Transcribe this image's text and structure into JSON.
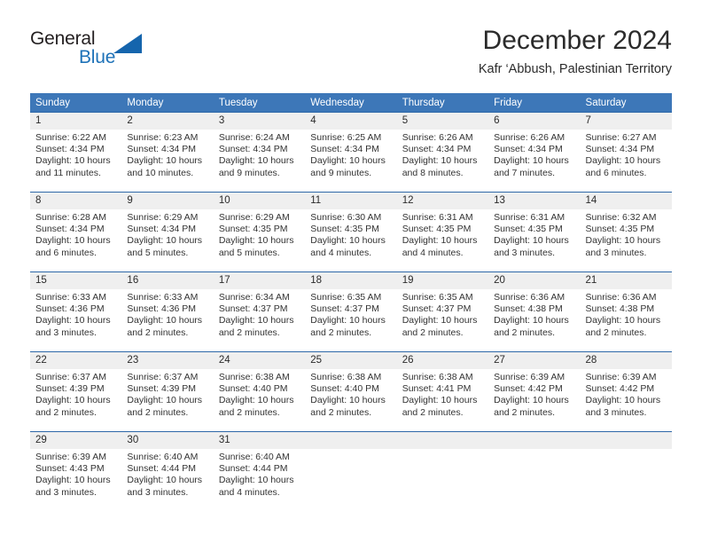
{
  "brand": {
    "name_top": "General",
    "name_bottom": "Blue",
    "triangle_icon": "triangle-icon",
    "accent_color": "#1e72b8"
  },
  "header": {
    "month_title": "December 2024",
    "location": "Kafr ‘Abbush, Palestinian Territory"
  },
  "theme": {
    "header_blue": "#3d77b8",
    "row_border_blue": "#2e68a8",
    "daynum_band": "#efefef"
  },
  "weekday_headers": [
    "Sunday",
    "Monday",
    "Tuesday",
    "Wednesday",
    "Thursday",
    "Friday",
    "Saturday"
  ],
  "labels": {
    "sunrise_prefix": "Sunrise:",
    "sunset_prefix": "Sunset:",
    "daylight_prefix": "Daylight:"
  },
  "calendar_data": {
    "month": "December",
    "year": 2024,
    "first_weekday": "Sunday",
    "weeks": [
      [
        {
          "day": "1",
          "sunrise": "Sunrise: 6:22 AM",
          "sunset": "Sunset: 4:34 PM",
          "daylight_line1": "Daylight: 10 hours",
          "daylight_line2": "and 11 minutes."
        },
        {
          "day": "2",
          "sunrise": "Sunrise: 6:23 AM",
          "sunset": "Sunset: 4:34 PM",
          "daylight_line1": "Daylight: 10 hours",
          "daylight_line2": "and 10 minutes."
        },
        {
          "day": "3",
          "sunrise": "Sunrise: 6:24 AM",
          "sunset": "Sunset: 4:34 PM",
          "daylight_line1": "Daylight: 10 hours",
          "daylight_line2": "and 9 minutes."
        },
        {
          "day": "4",
          "sunrise": "Sunrise: 6:25 AM",
          "sunset": "Sunset: 4:34 PM",
          "daylight_line1": "Daylight: 10 hours",
          "daylight_line2": "and 9 minutes."
        },
        {
          "day": "5",
          "sunrise": "Sunrise: 6:26 AM",
          "sunset": "Sunset: 4:34 PM",
          "daylight_line1": "Daylight: 10 hours",
          "daylight_line2": "and 8 minutes."
        },
        {
          "day": "6",
          "sunrise": "Sunrise: 6:26 AM",
          "sunset": "Sunset: 4:34 PM",
          "daylight_line1": "Daylight: 10 hours",
          "daylight_line2": "and 7 minutes."
        },
        {
          "day": "7",
          "sunrise": "Sunrise: 6:27 AM",
          "sunset": "Sunset: 4:34 PM",
          "daylight_line1": "Daylight: 10 hours",
          "daylight_line2": "and 6 minutes."
        }
      ],
      [
        {
          "day": "8",
          "sunrise": "Sunrise: 6:28 AM",
          "sunset": "Sunset: 4:34 PM",
          "daylight_line1": "Daylight: 10 hours",
          "daylight_line2": "and 6 minutes."
        },
        {
          "day": "9",
          "sunrise": "Sunrise: 6:29 AM",
          "sunset": "Sunset: 4:34 PM",
          "daylight_line1": "Daylight: 10 hours",
          "daylight_line2": "and 5 minutes."
        },
        {
          "day": "10",
          "sunrise": "Sunrise: 6:29 AM",
          "sunset": "Sunset: 4:35 PM",
          "daylight_line1": "Daylight: 10 hours",
          "daylight_line2": "and 5 minutes."
        },
        {
          "day": "11",
          "sunrise": "Sunrise: 6:30 AM",
          "sunset": "Sunset: 4:35 PM",
          "daylight_line1": "Daylight: 10 hours",
          "daylight_line2": "and 4 minutes."
        },
        {
          "day": "12",
          "sunrise": "Sunrise: 6:31 AM",
          "sunset": "Sunset: 4:35 PM",
          "daylight_line1": "Daylight: 10 hours",
          "daylight_line2": "and 4 minutes."
        },
        {
          "day": "13",
          "sunrise": "Sunrise: 6:31 AM",
          "sunset": "Sunset: 4:35 PM",
          "daylight_line1": "Daylight: 10 hours",
          "daylight_line2": "and 3 minutes."
        },
        {
          "day": "14",
          "sunrise": "Sunrise: 6:32 AM",
          "sunset": "Sunset: 4:35 PM",
          "daylight_line1": "Daylight: 10 hours",
          "daylight_line2": "and 3 minutes."
        }
      ],
      [
        {
          "day": "15",
          "sunrise": "Sunrise: 6:33 AM",
          "sunset": "Sunset: 4:36 PM",
          "daylight_line1": "Daylight: 10 hours",
          "daylight_line2": "and 3 minutes."
        },
        {
          "day": "16",
          "sunrise": "Sunrise: 6:33 AM",
          "sunset": "Sunset: 4:36 PM",
          "daylight_line1": "Daylight: 10 hours",
          "daylight_line2": "and 2 minutes."
        },
        {
          "day": "17",
          "sunrise": "Sunrise: 6:34 AM",
          "sunset": "Sunset: 4:37 PM",
          "daylight_line1": "Daylight: 10 hours",
          "daylight_line2": "and 2 minutes."
        },
        {
          "day": "18",
          "sunrise": "Sunrise: 6:35 AM",
          "sunset": "Sunset: 4:37 PM",
          "daylight_line1": "Daylight: 10 hours",
          "daylight_line2": "and 2 minutes."
        },
        {
          "day": "19",
          "sunrise": "Sunrise: 6:35 AM",
          "sunset": "Sunset: 4:37 PM",
          "daylight_line1": "Daylight: 10 hours",
          "daylight_line2": "and 2 minutes."
        },
        {
          "day": "20",
          "sunrise": "Sunrise: 6:36 AM",
          "sunset": "Sunset: 4:38 PM",
          "daylight_line1": "Daylight: 10 hours",
          "daylight_line2": "and 2 minutes."
        },
        {
          "day": "21",
          "sunrise": "Sunrise: 6:36 AM",
          "sunset": "Sunset: 4:38 PM",
          "daylight_line1": "Daylight: 10 hours",
          "daylight_line2": "and 2 minutes."
        }
      ],
      [
        {
          "day": "22",
          "sunrise": "Sunrise: 6:37 AM",
          "sunset": "Sunset: 4:39 PM",
          "daylight_line1": "Daylight: 10 hours",
          "daylight_line2": "and 2 minutes."
        },
        {
          "day": "23",
          "sunrise": "Sunrise: 6:37 AM",
          "sunset": "Sunset: 4:39 PM",
          "daylight_line1": "Daylight: 10 hours",
          "daylight_line2": "and 2 minutes."
        },
        {
          "day": "24",
          "sunrise": "Sunrise: 6:38 AM",
          "sunset": "Sunset: 4:40 PM",
          "daylight_line1": "Daylight: 10 hours",
          "daylight_line2": "and 2 minutes."
        },
        {
          "day": "25",
          "sunrise": "Sunrise: 6:38 AM",
          "sunset": "Sunset: 4:40 PM",
          "daylight_line1": "Daylight: 10 hours",
          "daylight_line2": "and 2 minutes."
        },
        {
          "day": "26",
          "sunrise": "Sunrise: 6:38 AM",
          "sunset": "Sunset: 4:41 PM",
          "daylight_line1": "Daylight: 10 hours",
          "daylight_line2": "and 2 minutes."
        },
        {
          "day": "27",
          "sunrise": "Sunrise: 6:39 AM",
          "sunset": "Sunset: 4:42 PM",
          "daylight_line1": "Daylight: 10 hours",
          "daylight_line2": "and 2 minutes."
        },
        {
          "day": "28",
          "sunrise": "Sunrise: 6:39 AM",
          "sunset": "Sunset: 4:42 PM",
          "daylight_line1": "Daylight: 10 hours",
          "daylight_line2": "and 3 minutes."
        }
      ],
      [
        {
          "day": "29",
          "sunrise": "Sunrise: 6:39 AM",
          "sunset": "Sunset: 4:43 PM",
          "daylight_line1": "Daylight: 10 hours",
          "daylight_line2": "and 3 minutes."
        },
        {
          "day": "30",
          "sunrise": "Sunrise: 6:40 AM",
          "sunset": "Sunset: 4:44 PM",
          "daylight_line1": "Daylight: 10 hours",
          "daylight_line2": "and 3 minutes."
        },
        {
          "day": "31",
          "sunrise": "Sunrise: 6:40 AM",
          "sunset": "Sunset: 4:44 PM",
          "daylight_line1": "Daylight: 10 hours",
          "daylight_line2": "and 4 minutes."
        },
        {
          "day": "",
          "sunrise": "",
          "sunset": "",
          "daylight_line1": "",
          "daylight_line2": ""
        },
        {
          "day": "",
          "sunrise": "",
          "sunset": "",
          "daylight_line1": "",
          "daylight_line2": ""
        },
        {
          "day": "",
          "sunrise": "",
          "sunset": "",
          "daylight_line1": "",
          "daylight_line2": ""
        },
        {
          "day": "",
          "sunrise": "",
          "sunset": "",
          "daylight_line1": "",
          "daylight_line2": ""
        }
      ]
    ]
  }
}
